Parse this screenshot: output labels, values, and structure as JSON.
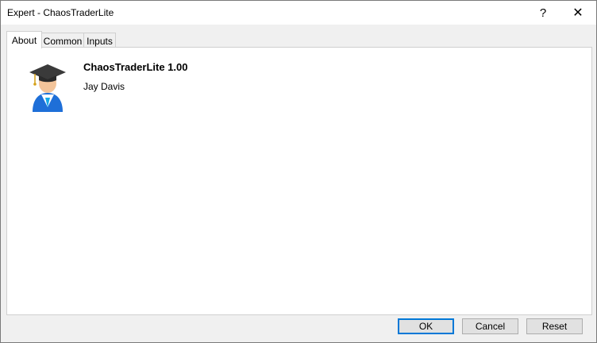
{
  "window": {
    "title": "Expert - ChaosTraderLite",
    "help_glyph": "?",
    "close_glyph": "✕"
  },
  "tabs": [
    {
      "label": "About"
    },
    {
      "label": "Common"
    },
    {
      "label": "Inputs"
    }
  ],
  "about": {
    "product_name": "ChaosTraderLite 1.00",
    "author": "Jay Davis",
    "icon": "expert-graduate-icon"
  },
  "buttons": {
    "ok": "OK",
    "cancel": "Cancel",
    "reset": "Reset"
  },
  "colors": {
    "accent": "#0078d7",
    "icon_blue": "#1e6fd8",
    "cap": "#3a3a3a"
  }
}
